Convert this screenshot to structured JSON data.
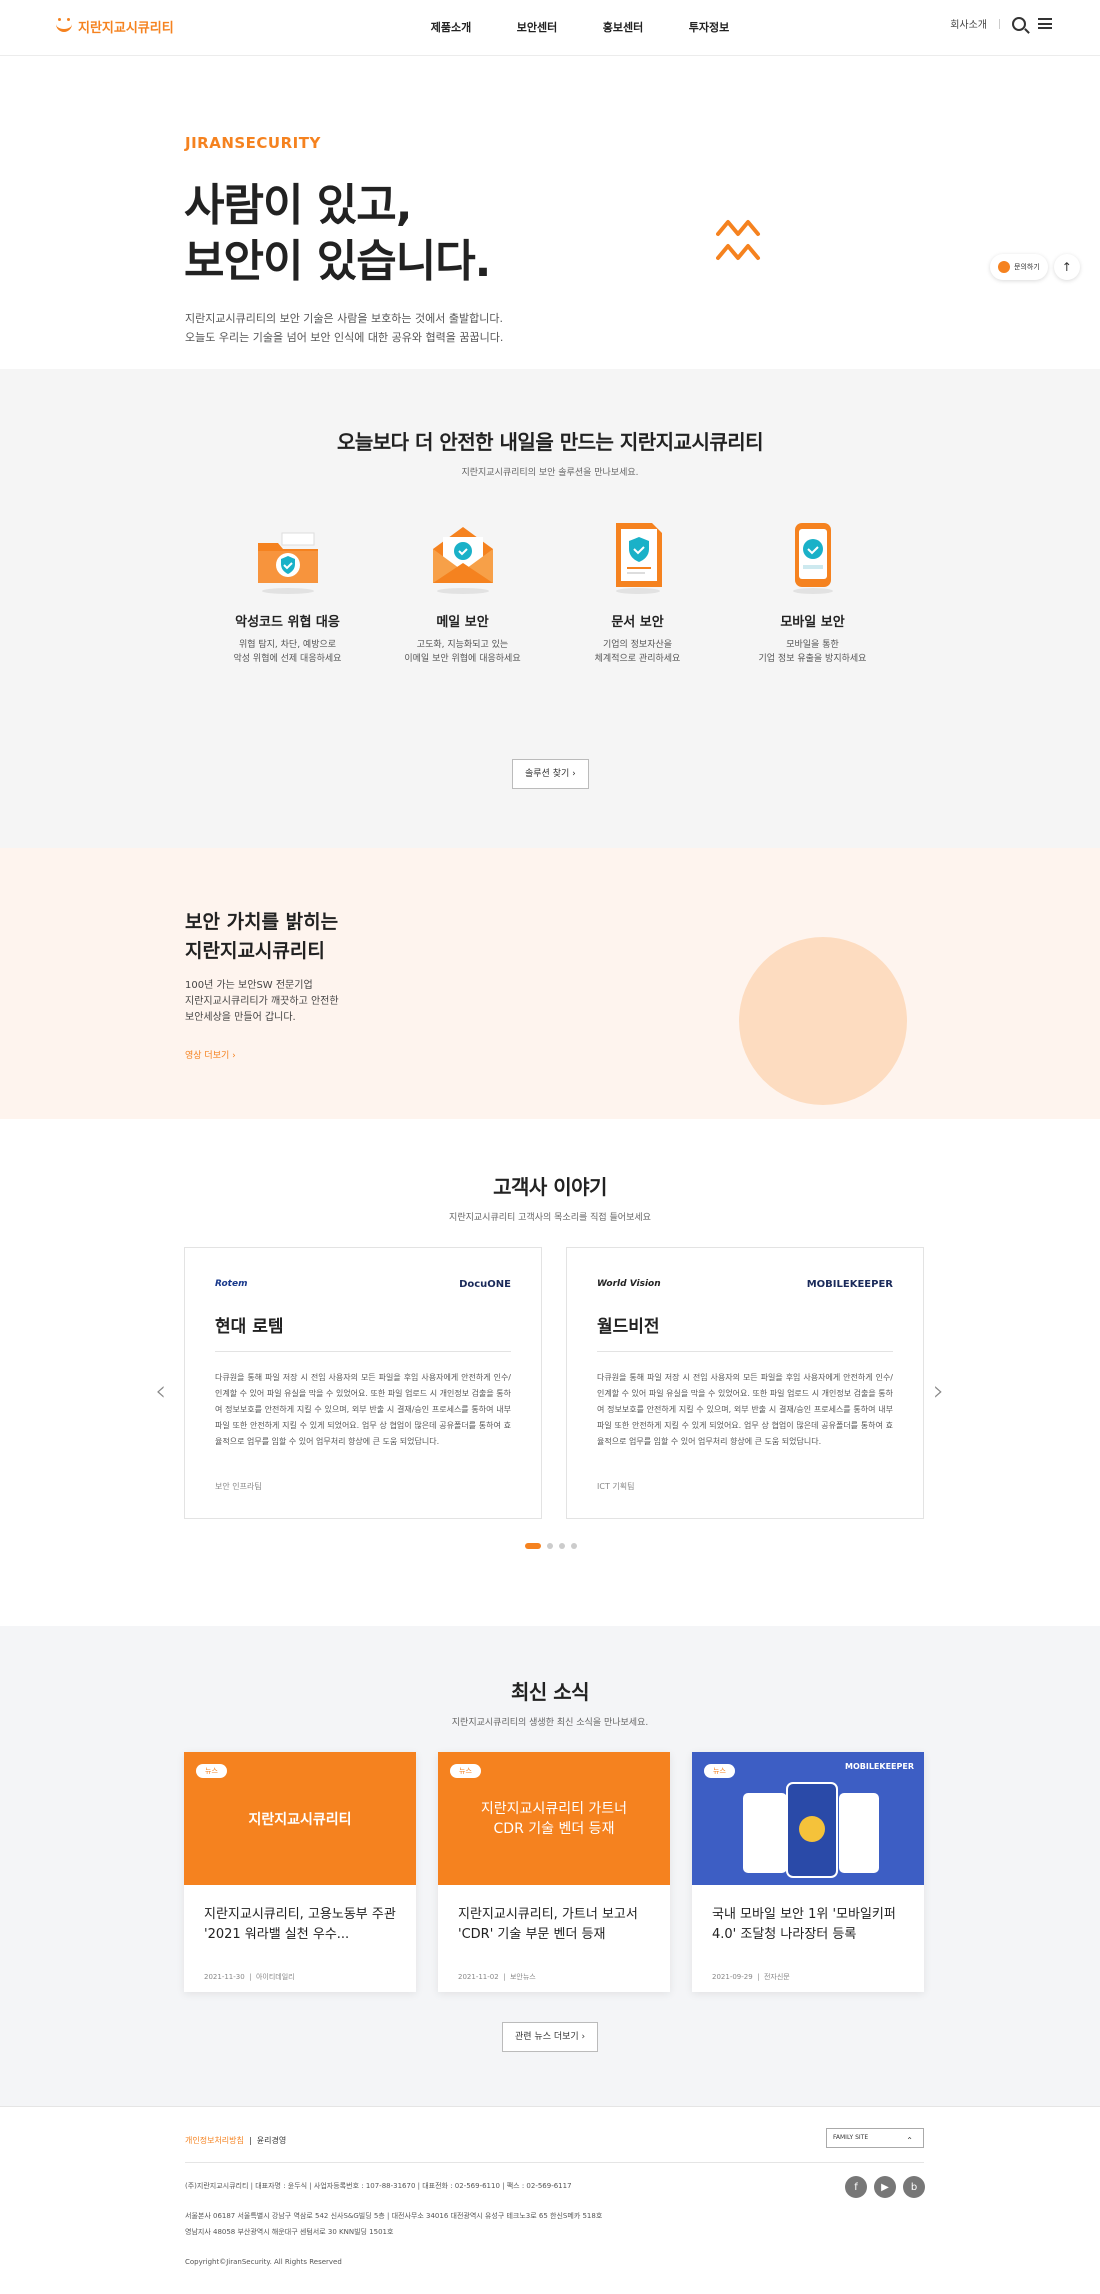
{
  "header": {
    "logo": "지란지교시큐리티",
    "menu": [
      "제품소개",
      "보안센터",
      "홍보센터",
      "투자정보"
    ],
    "company": "회사소개"
  },
  "hero": {
    "brand": "JIRANSECURITY",
    "title_line1": "사람이 있고,",
    "title_line2": "보안이 있습니다.",
    "desc_line1": "지란지교시큐리티의 보안 기술은 사람을 보호하는 것에서 출발합니다.",
    "desc_line2": "오늘도 우리는 기술을 넘어 보안 인식에 대한 공유와 협력을 꿈꿉니다.",
    "inquiry": "문의하기",
    "top": "↑"
  },
  "solutions": {
    "title": "오늘보다 더 안전한 내일을 만드는 지란지교시큐리티",
    "subtitle": "지란지교시큐리티의 보안 솔루션을 만나보세요.",
    "items": [
      {
        "name": "악성코드 위협 대응",
        "desc1": "위협 탐지, 차단, 예방으로",
        "desc2": "악성 위협에 선제 대응하세요",
        "icon": "folder-shield-icon"
      },
      {
        "name": "메일 보안",
        "desc1": "고도화, 지능화되고 있는",
        "desc2": "이메일 보안 위협에 대응하세요",
        "icon": "mail-shield-icon"
      },
      {
        "name": "문서 보안",
        "desc1": "기업의 정보자산을",
        "desc2": "체계적으로 관리하세요",
        "icon": "document-shield-icon"
      },
      {
        "name": "모바일 보안",
        "desc1": "모바일을 통한",
        "desc2": "기업 정보 유출을 방지하세요",
        "icon": "mobile-check-icon"
      }
    ],
    "button": "솔루션 찾기 ›"
  },
  "value": {
    "title_line1": "보안 가치를 밝히는",
    "title_line2": "지란지교시큐리티",
    "desc_line1": "100년 가는 보안SW 전문기업",
    "desc_line2": "지란지교시큐리티가 깨끗하고 안전한",
    "desc_line3": "보안세상을 만들어 갑니다.",
    "more": "영상 더보기 ›"
  },
  "customers": {
    "title": "고객사 이야기",
    "subtitle": "지란지교시큐리티 고객사의 목소리를 직접 들어보세요",
    "cards": [
      {
        "client_logo": "Rotem",
        "product_logo": "DocuONE",
        "name": "현대 로템",
        "body": "다큐원을 통해 파일 저장 시 전임 사용자의 모든 파일을 후임 사용자에게 안전하게 인수/인계할 수 있어 파일 유실을 막을 수 있었어요. 또한 파일 업로드 시 개인정보 검출을 통하여 정보보호를 안전하게 지킬 수 있으며, 외부 반출 시 결재/승인 프로세스를 통하여 내부 파일 또한 안전하게 지킬 수 있게 되었어요. 업무 상 협업이 많은데 공유폴더를 통하여 효율적으로 업무를 임할 수 있어 업무처리 향상에 큰 도움 되었답니다.",
        "meta": "보안 인프라팀"
      },
      {
        "client_logo": "World Vision",
        "product_logo": "MOBILEKEEPER",
        "name": "월드비전",
        "body": "다큐원을 통해 파일 저장 시 전임 사용자의 모든 파일을 후임 사용자에게 안전하게 인수/인계할 수 있어 파일 유실을 막을 수 있었어요. 또한 파일 업로드 시 개인정보 검출을 통하여 정보보호를 안전하게 지킬 수 있으며, 외부 반출 시 결재/승인 프로세스를 통하여 내부 파일 또한 안전하게 지킬 수 있게 되었어요. 업무 상 협업이 많은데 공유폴더를 통하여 효율적으로 업무를 임할 수 있어 업무처리 향상에 큰 도움 되었답니다.",
        "meta": "ICT 기획팀"
      }
    ],
    "prev": "‹",
    "next": "›"
  },
  "news": {
    "title": "최신 소식",
    "subtitle": "지란지교시큐리티의 생생한 최신 소식을 만나보세요.",
    "items": [
      {
        "tag": "뉴스",
        "thumb": "지란지교시큐리티",
        "title": "지란지교시큐리티, 고용노동부 주관 '2021 워라밸 실천 우수...",
        "date": "2021-11-30",
        "source": "아이티데일리"
      },
      {
        "tag": "뉴스",
        "thumb": "지란지교시큐리티 가트너 CDR 기술 벤더 등재",
        "title": "지란지교시큐리티, 가트너 보고서 'CDR' 기술 부문 벤더 등재",
        "date": "2021-11-02",
        "source": "보안뉴스"
      },
      {
        "tag": "뉴스",
        "thumb": "MOBILEKEEPER",
        "title": "국내 모바일 보안 1위 '모바일키퍼 4.0' 조달청 나라장터 등록",
        "date": "2021-09-29",
        "source": "전자신문"
      }
    ],
    "button": "관련 뉴스 더보기 ›"
  },
  "footer": {
    "privacy": "개인정보처리방침",
    "ethics": "윤리경영",
    "family": "FAMILY SITE",
    "company_info": "(주)지란지교시큐리티 | 대표자명 : 윤두식 | 사업자등록번호 : 107-88-31670 | 대표전화 : 02-569-6110 | 팩스 : 02-569-6117",
    "seoul": "서울본사 06187 서울특별시 강남구 역삼로 542 신사S&G빌딩 5층 | 대전사무소 34016 대전광역시 유성구 테크노3로 65 한신S메카 518호",
    "yeongnam": "영남지사 48058 부산광역시 해운대구 센텀서로 30 KNN빌딩 1501호",
    "copyright": "Copyright©JiranSecurity. All Rights Reserved",
    "social": [
      "f",
      "▶",
      "b"
    ]
  }
}
